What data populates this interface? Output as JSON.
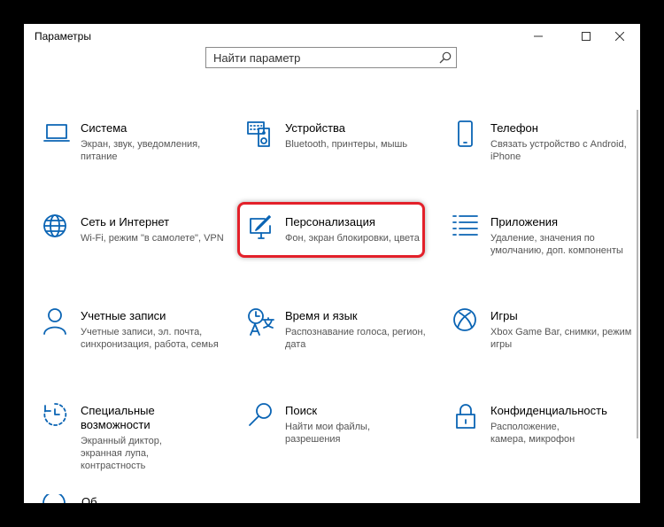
{
  "window": {
    "title": "Параметры",
    "controls": [
      "minimize",
      "maximize",
      "close"
    ]
  },
  "search": {
    "placeholder": "Найти параметр",
    "icon": "search-icon"
  },
  "categories": [
    {
      "id": "system",
      "title": "Система",
      "desc": "Экран, звук, уведомления, питание",
      "icon": "laptop-icon"
    },
    {
      "id": "devices",
      "title": "Устройства",
      "desc": "Bluetooth, принтеры, мышь",
      "icon": "keyboard-speaker-icon"
    },
    {
      "id": "phone",
      "title": "Телефон",
      "desc": "Связать устройство с Android, iPhone",
      "icon": "phone-icon"
    },
    {
      "id": "network",
      "title": "Сеть и Интернет",
      "desc": "Wi-Fi, режим \"в самолете\", VPN",
      "icon": "globe-icon"
    },
    {
      "id": "personalization",
      "title": "Персонализация",
      "desc": "Фон, экран блокировки, цвета",
      "icon": "paint-screen-icon"
    },
    {
      "id": "apps",
      "title": "Приложения",
      "desc": "Удаление, значения по умолчанию, доп. компоненты",
      "icon": "apps-list-icon"
    },
    {
      "id": "accounts",
      "title": "Учетные записи",
      "desc": "Учетные записи, эл. почта, синхронизация, работа, семья",
      "icon": "person-icon"
    },
    {
      "id": "time",
      "title": "Время и язык",
      "desc": "Распознавание голоса, регион, дата",
      "icon": "time-language-icon"
    },
    {
      "id": "gaming",
      "title": "Игры",
      "desc": "Xbox Game Bar, снимки, режим игры",
      "icon": "xbox-icon"
    },
    {
      "id": "ease",
      "title": "Специальные возможности",
      "desc": "Экранный диктор, экранная лупа, контрастность",
      "icon": "ease-of-access-icon"
    },
    {
      "id": "search",
      "title": "Поиск",
      "desc": "Найти мои файлы, разрешения",
      "icon": "search-icon"
    },
    {
      "id": "privacy",
      "title": "Конфиденциальность",
      "desc": "Расположение, камера, микрофон",
      "icon": "lock-icon"
    }
  ],
  "highlighted_category": "personalization",
  "partial_item": {
    "title": "Об",
    "icon": "update-icon"
  },
  "accent_color": "#0a64b4",
  "highlight_color": "#e3202a"
}
